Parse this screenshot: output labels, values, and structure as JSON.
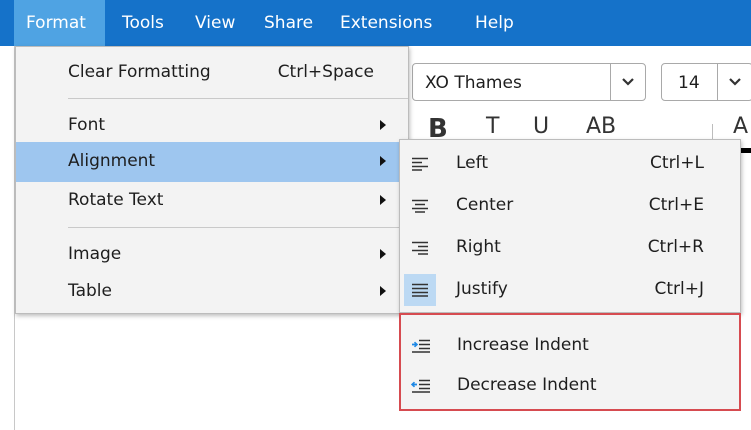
{
  "menubar": {
    "items": [
      {
        "label": "Format",
        "active": true
      },
      {
        "label": "Tools"
      },
      {
        "label": "View"
      },
      {
        "label": "Share"
      },
      {
        "label": "Extensions"
      },
      {
        "label": "Help"
      }
    ]
  },
  "toolbar": {
    "font_family": "XO Thames",
    "font_size": "14",
    "partial_glyphs": [
      "B",
      "T",
      "U",
      "AB",
      "A"
    ]
  },
  "format_menu": {
    "items": [
      {
        "label": "Clear Formatting",
        "shortcut": "Ctrl+Space"
      },
      {
        "label": "Font",
        "submenu": true
      },
      {
        "label": "Alignment",
        "submenu": true,
        "highlighted": true
      },
      {
        "label": "Rotate Text",
        "submenu": true
      },
      {
        "label": "Image",
        "submenu": true
      },
      {
        "label": "Table",
        "submenu": true
      }
    ]
  },
  "alignment_menu": {
    "items": [
      {
        "label": "Left",
        "shortcut": "Ctrl+L",
        "icon": "align-left-icon"
      },
      {
        "label": "Center",
        "shortcut": "Ctrl+E",
        "icon": "align-center-icon"
      },
      {
        "label": "Right",
        "shortcut": "Ctrl+R",
        "icon": "align-right-icon"
      },
      {
        "label": "Justify",
        "shortcut": "Ctrl+J",
        "icon": "align-justify-icon",
        "selected": true
      }
    ],
    "indent_items": [
      {
        "label": "Increase Indent",
        "icon": "increase-indent-icon"
      },
      {
        "label": "Decrease Indent",
        "icon": "decrease-indent-icon"
      }
    ]
  },
  "colors": {
    "menubar": "#1572c9",
    "menubar_active": "#4fa3e3",
    "highlight": "#9ec6ef",
    "selected_icon_bg": "#bcd9f3",
    "indent_border": "#d64b50",
    "icon_blue": "#1e88e5"
  }
}
